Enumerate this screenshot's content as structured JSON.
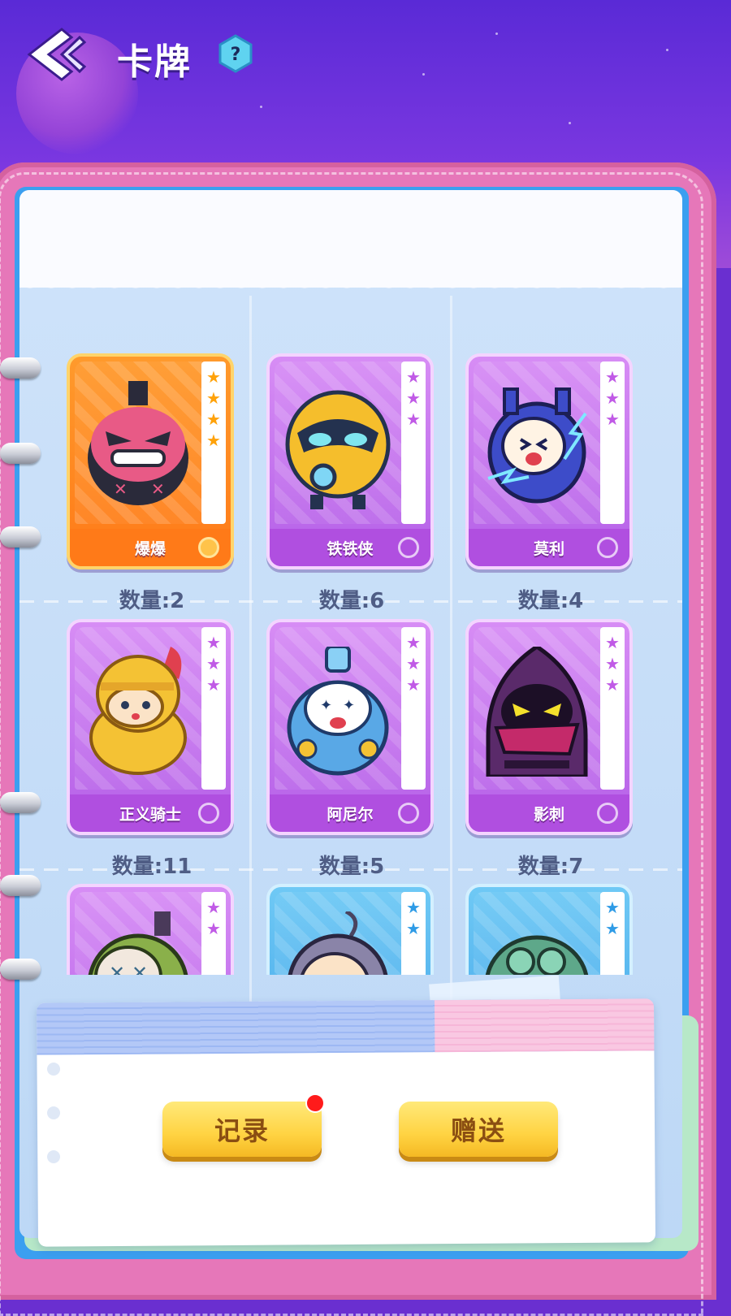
{
  "header": {
    "title": "卡牌",
    "help_label": "?"
  },
  "cards": [
    {
      "name": "爆爆",
      "count_label": "数量:2",
      "rarity": "gold",
      "stars": 4,
      "colors": {
        "body": "#e85a86",
        "accent": "#2a2a3a"
      }
    },
    {
      "name": "铁铁侠",
      "count_label": "数量:6",
      "rarity": "purple",
      "stars": 3,
      "colors": {
        "body": "#f5be2c",
        "accent": "#24324f"
      }
    },
    {
      "name": "莫利",
      "count_label": "数量:4",
      "rarity": "purple",
      "stars": 3,
      "colors": {
        "body": "#3d4cc9",
        "accent": "#fff3e4"
      }
    },
    {
      "name": "正义骑士",
      "count_label": "数量:11",
      "rarity": "purple",
      "stars": 3,
      "colors": {
        "body": "#f4c234",
        "accent": "#fbe3c7"
      }
    },
    {
      "name": "阿尼尔",
      "count_label": "数量:5",
      "rarity": "purple",
      "stars": 3,
      "colors": {
        "body": "#59a8e6",
        "accent": "#ffffff"
      }
    },
    {
      "name": "影刺",
      "count_label": "数量:7",
      "rarity": "purple",
      "stars": 3,
      "colors": {
        "body": "#5a2a6a",
        "accent": "#c42a6a"
      }
    },
    {
      "name": "",
      "count_label": "",
      "rarity": "purple",
      "stars": 2,
      "colors": {
        "body": "#8ab04a",
        "accent": "#f2e8de"
      }
    },
    {
      "name": "",
      "count_label": "",
      "rarity": "blue",
      "stars": 2,
      "colors": {
        "body": "#8a84a8",
        "accent": "#fbe3c7"
      }
    },
    {
      "name": "",
      "count_label": "",
      "rarity": "blue",
      "stars": 2,
      "colors": {
        "body": "#5ea88a",
        "accent": "#2a5a4a"
      }
    }
  ],
  "buttons": {
    "record_label": "记录",
    "gift_label": "赠送"
  },
  "colors": {
    "bg_purple": "#6a2fd0",
    "notebook_pink": "#e677b9",
    "page_blue": "#cfe3fa",
    "button_yellow": "#ffd342",
    "notification_red": "#ff1b1b"
  }
}
